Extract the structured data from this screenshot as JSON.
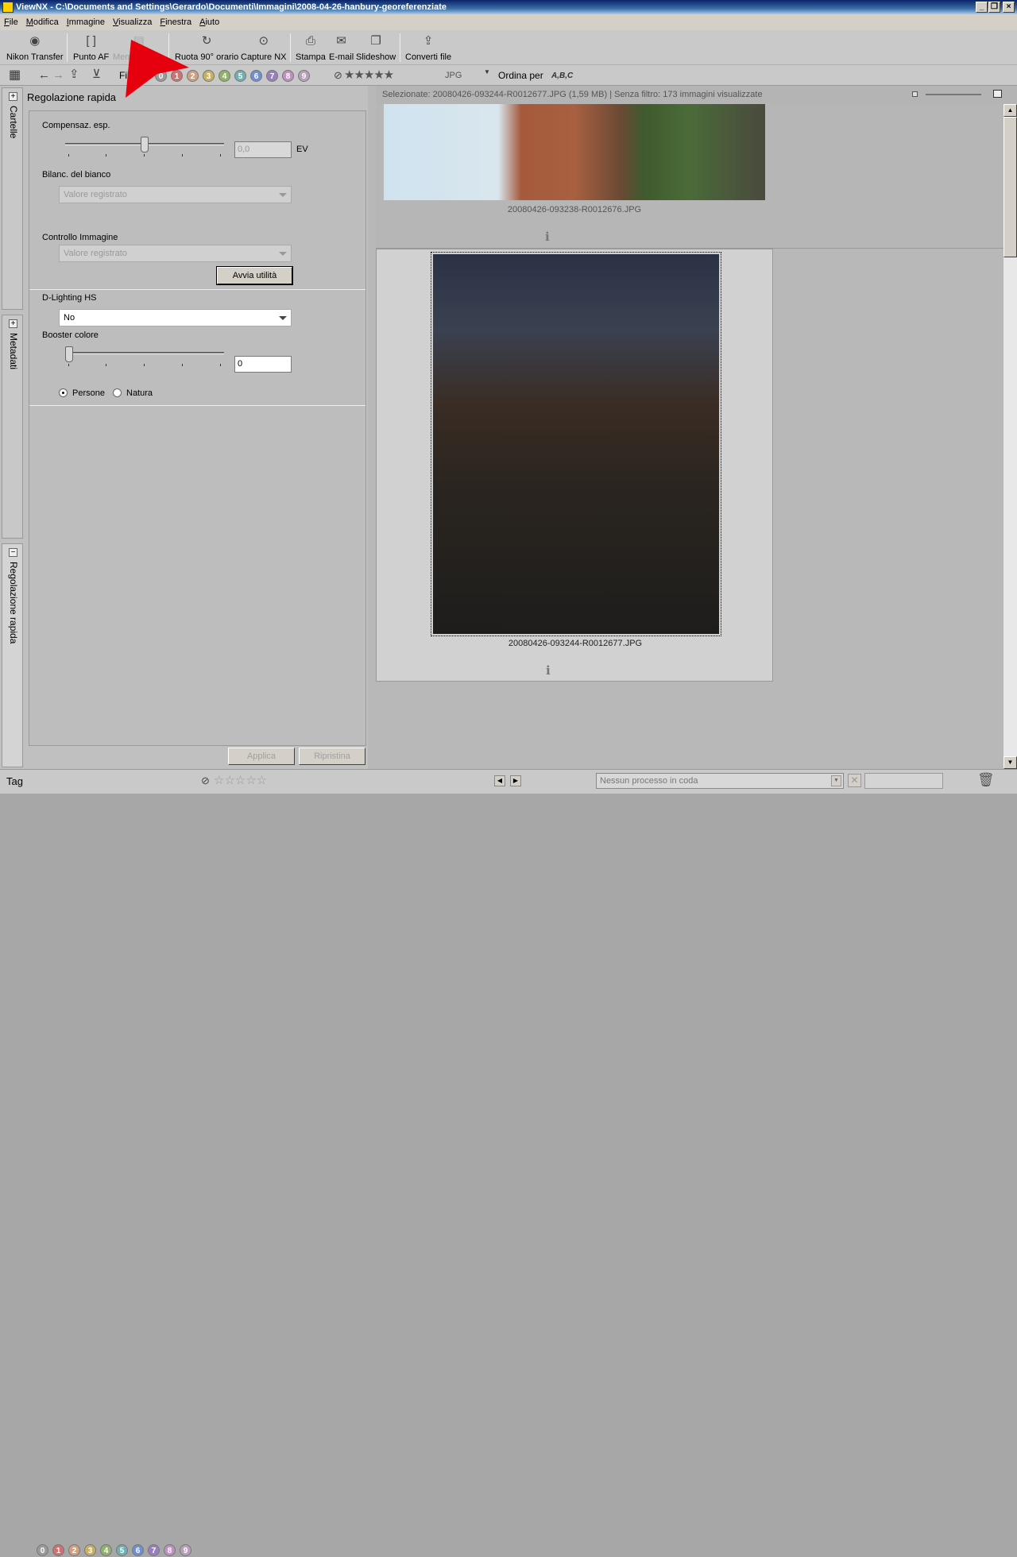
{
  "window": {
    "title": "ViewNX - C:\\Documents and Settings\\Gerardo\\Documenti\\Immagini\\2008-04-26-hanbury-georeferenziate",
    "min_glyph": "_",
    "max_glyph": "❐",
    "close_glyph": "×"
  },
  "menu": [
    "File",
    "Modifica",
    "Immagine",
    "Visualizza",
    "Finestra",
    "Aiuto"
  ],
  "toolbar": [
    {
      "label": "Nikon Transfer",
      "icon": "camera-icon",
      "glyph": "◉",
      "enabled": true
    },
    {
      "label": "Punto AF",
      "icon": "af-point-icon",
      "glyph": "[ ]",
      "enabled": true
    },
    {
      "label": "Memo vocale",
      "icon": "voice-memo-icon",
      "glyph": "▤",
      "enabled": false
    },
    {
      "label": "Ruota 90° orario",
      "icon": "rotate-icon",
      "glyph": "↻",
      "enabled": true
    },
    {
      "label": "Capture NX",
      "icon": "capture-nx-icon",
      "glyph": "⊙",
      "enabled": true
    },
    {
      "label": "Stampa",
      "icon": "print-icon",
      "glyph": "⎙",
      "enabled": true
    },
    {
      "label": "E-mail",
      "icon": "email-icon",
      "glyph": "✉",
      "enabled": true
    },
    {
      "label": "Slideshow",
      "icon": "slideshow-icon",
      "glyph": "❐",
      "enabled": true
    },
    {
      "label": "Converti file",
      "icon": "convert-file-icon",
      "glyph": "⇪",
      "enabled": true
    }
  ],
  "filterbar": {
    "filter_label": "Filtr",
    "labels": [
      "0",
      "1",
      "2",
      "3",
      "4",
      "5",
      "6",
      "7",
      "8",
      "9"
    ],
    "label_colors": [
      "#9a9a9a",
      "#d07070",
      "#d0a080",
      "#c9b060",
      "#8fb36a",
      "#6fb0b0",
      "#6f8fd0",
      "#9a7fc0",
      "#c090c0",
      "#b9a0b9"
    ],
    "format": "JPG",
    "sort_label": "Ordina per",
    "sort_glyph": "A,B,C",
    "stars": "★★★★★",
    "no_rating_glyph": "⃠"
  },
  "side_tabs": [
    "Cartelle",
    "Metadati",
    "Regolazione rapida"
  ],
  "quick_adjust": {
    "title": "Regolazione rapida",
    "exposure_label": "Compensaz. esp.",
    "exposure_value": "0,0",
    "exposure_unit": "EV",
    "exposure_level": 0.5,
    "wb_label": "Bilanc. del bianco",
    "wb_value": "Valore registrato",
    "picture_control_label": "Controllo Immagine",
    "picture_control_value": "Valore registrato",
    "launch_utility": "Avvia utilità",
    "dlighting_label": "D-Lighting HS",
    "dlighting_value": "No",
    "booster_label": "Booster colore",
    "booster_value": "0",
    "booster_level": 0,
    "radio_people": "Persone",
    "radio_nature": "Natura",
    "apply": "Applica",
    "reset": "Ripristina"
  },
  "browser": {
    "status": "Selezionate: 20080426-093244-R0012677.JPG (1,59 MB) | Senza filtro: 173 immagini visualizzate",
    "thumbnails": [
      {
        "filename": "20080426-093238-R0012676.JPG",
        "selected": false
      },
      {
        "filename": "20080426-093244-R0012677.JPG",
        "selected": true
      }
    ],
    "info_glyph": "i"
  },
  "statusbar": {
    "tag_label": "Tag",
    "queue_text": "Nessun processo in coda"
  }
}
